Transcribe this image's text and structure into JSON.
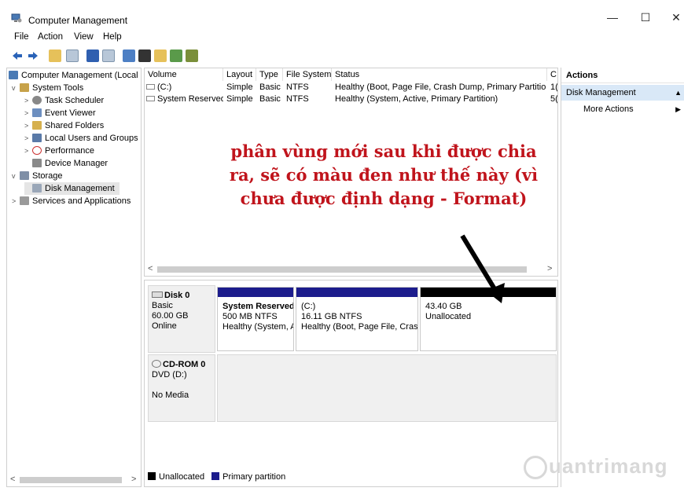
{
  "window": {
    "title": "Computer Management",
    "controls": {
      "minimize": "—",
      "maximize": "☐",
      "close": "✕"
    }
  },
  "menu": [
    "File",
    "Action",
    "View",
    "Help"
  ],
  "toolbar_icons": [
    "back-icon",
    "forward-icon",
    "up-folder-icon",
    "show-hide-tree-icon",
    "help-icon",
    "properties-icon",
    "refresh-icon",
    "export-icon",
    "open-icon",
    "search-icon",
    "extra-icon"
  ],
  "tree": {
    "root": "Computer Management (Local",
    "items": [
      {
        "label": "System Tools",
        "level": 1,
        "expander": "v"
      },
      {
        "label": "Task Scheduler",
        "level": 2,
        "expander": ">"
      },
      {
        "label": "Event Viewer",
        "level": 2,
        "expander": ">"
      },
      {
        "label": "Shared Folders",
        "level": 2,
        "expander": ">"
      },
      {
        "label": "Local Users and Groups",
        "level": 2,
        "expander": ">"
      },
      {
        "label": "Performance",
        "level": 2,
        "expander": ">"
      },
      {
        "label": "Device Manager",
        "level": 2,
        "expander": ""
      },
      {
        "label": "Storage",
        "level": 1,
        "expander": "v"
      },
      {
        "label": "Disk Management",
        "level": 2,
        "expander": "",
        "selected": true
      },
      {
        "label": "Services and Applications",
        "level": 1,
        "expander": ">"
      }
    ]
  },
  "volumes": {
    "columns": [
      "Volume",
      "Layout",
      "Type",
      "File System",
      "Status",
      "C"
    ],
    "rows": [
      [
        "(C:)",
        "Simple",
        "Basic",
        "NTFS",
        "Healthy (Boot, Page File, Crash Dump, Primary Partition)",
        "1("
      ],
      [
        "System Reserved",
        "Simple",
        "Basic",
        "NTFS",
        "Healthy (System, Active, Primary Partition)",
        "5("
      ]
    ]
  },
  "disks": [
    {
      "name": "Disk 0",
      "lines": [
        "Basic",
        "60.00 GB",
        "Online"
      ],
      "partitions": [
        {
          "title": "System Reserved",
          "size": "500 MB NTFS",
          "status": "Healthy (System, A",
          "color": "#1c1c8c"
        },
        {
          "title": "(C:)",
          "size": "16.11 GB NTFS",
          "status": "Healthy (Boot, Page File, Crash",
          "color": "#1c1c8c"
        },
        {
          "title": "",
          "size": "43.40 GB",
          "status": "Unallocated",
          "color": "#000000"
        }
      ]
    },
    {
      "name": "CD-ROM 0",
      "lines": [
        "DVD (D:)",
        "",
        "No Media"
      ]
    }
  ],
  "legend": [
    {
      "label": "Unallocated",
      "color": "#000000"
    },
    {
      "label": "Primary partition",
      "color": "#1c1c8c"
    }
  ],
  "actions": {
    "header": "Actions",
    "section": "Disk Management",
    "items": [
      "More Actions"
    ]
  },
  "annotation": {
    "text": "phân vùng mới sau khi được chia ra, sẽ có màu đen như thế này (vì chưa được định dạng - Format)",
    "color": "#c0141c"
  },
  "watermark": "uantrimang"
}
